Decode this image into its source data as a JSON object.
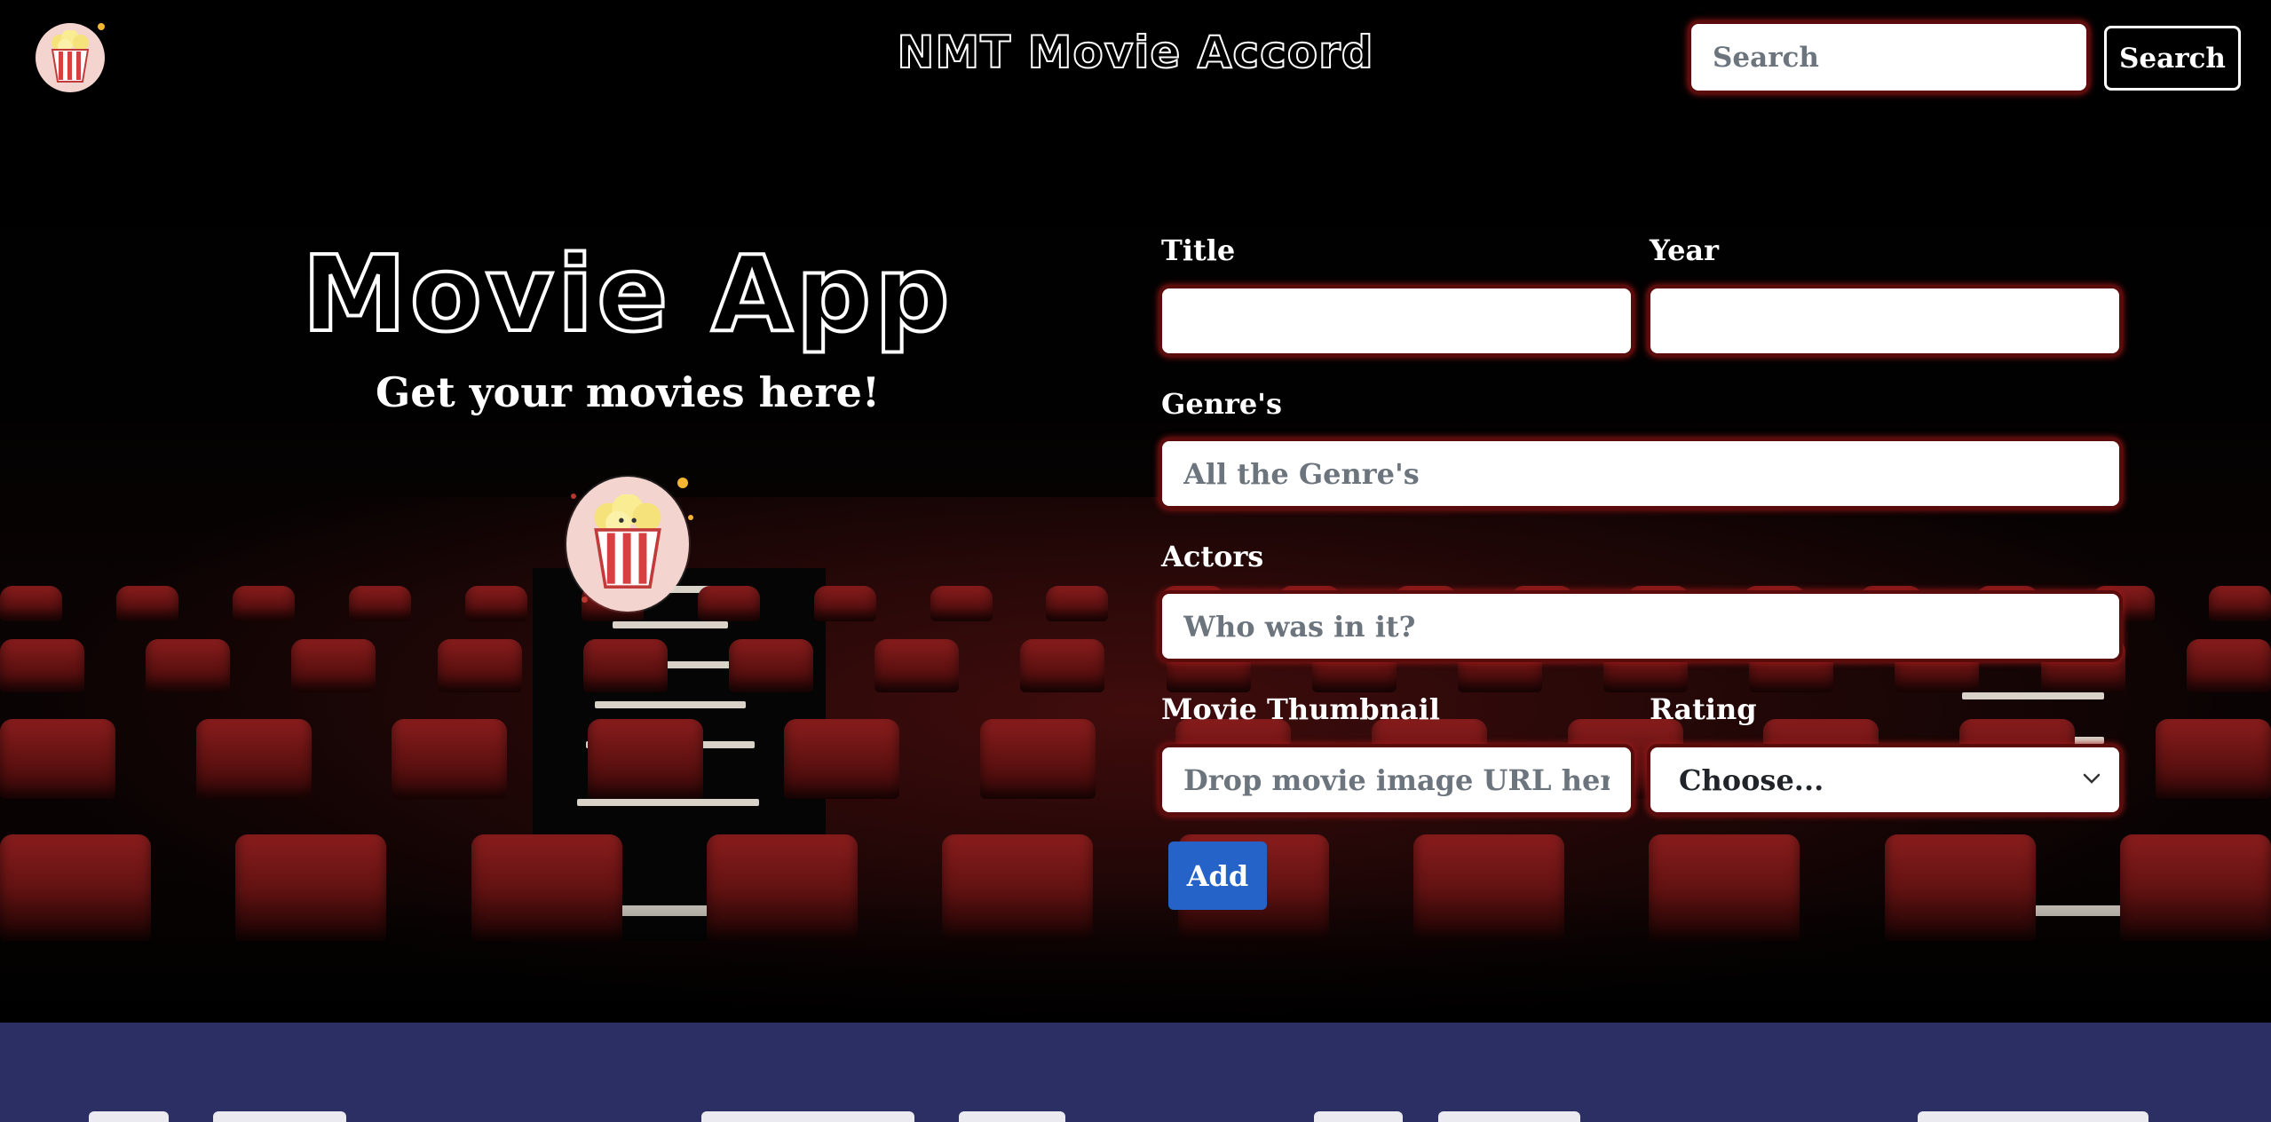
{
  "header": {
    "title": "NMT Movie Accord",
    "search_placeholder": "Search",
    "search_button": "Search"
  },
  "hero": {
    "title": "Movie App",
    "subtitle": "Get your movies here!"
  },
  "form": {
    "title_label": "Title",
    "title_value": "",
    "year_label": "Year",
    "year_value": "",
    "genres_label": "Genre's",
    "genres_placeholder": "All the Genre's",
    "actors_label": "Actors",
    "actors_placeholder": "Who was in it?",
    "thumbnail_label": "Movie Thumbnail",
    "thumbnail_placeholder": "Drop movie image URL here!",
    "rating_label": "Rating",
    "rating_selected": "Choose...",
    "add_button": "Add"
  },
  "icons": {
    "logo": "popcorn-icon",
    "select": "chevron-down-icon"
  },
  "colors": {
    "field_glow": "#a31818",
    "add_button": "#2563c9",
    "band": "#2b2f63",
    "seat": "#8a1d1d"
  }
}
